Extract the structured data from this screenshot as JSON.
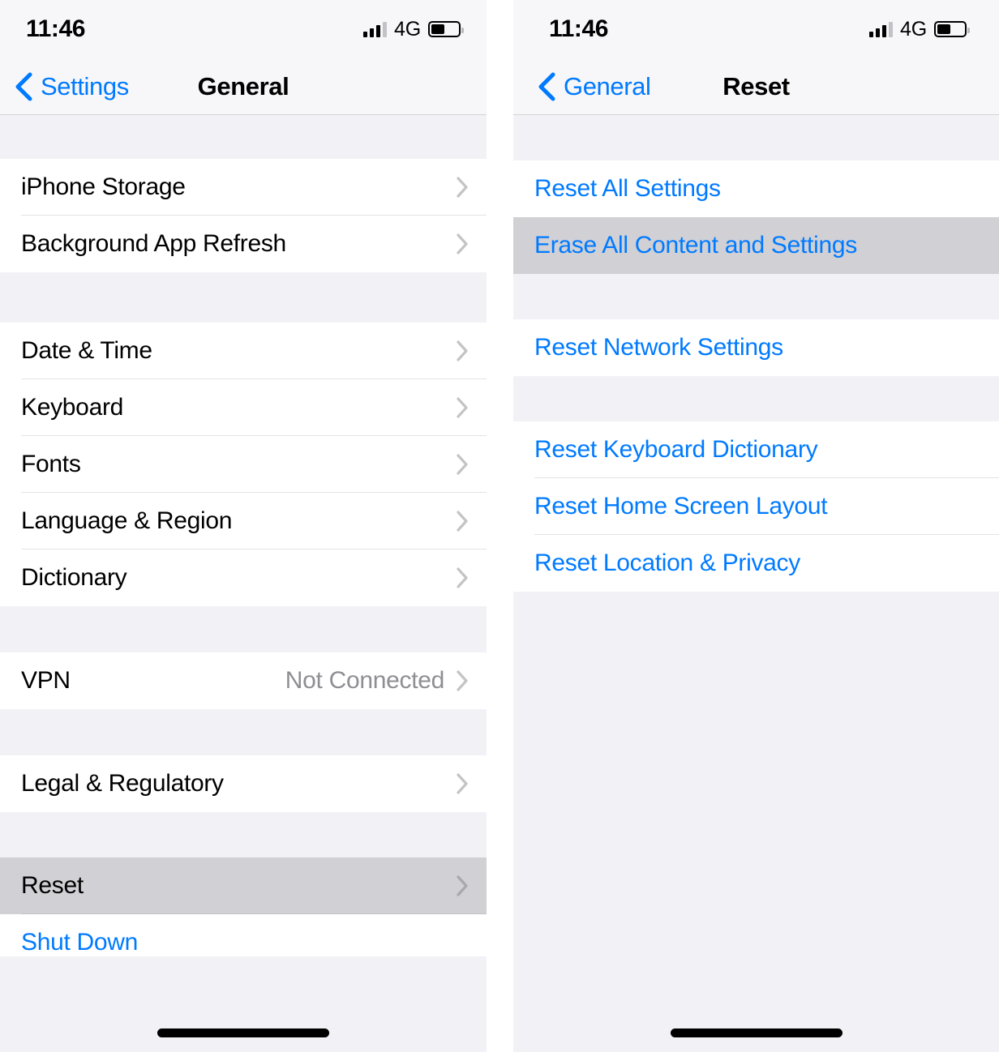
{
  "accent_color": "#007aff",
  "highlight_color": "#d0d0d5",
  "group_bg_color": "#f2f1f6",
  "screens": [
    {
      "id": "general",
      "status": {
        "time": "11:46",
        "carrier": "4G",
        "signal_icon": "cellular-bars-icon",
        "battery_icon": "battery-icon",
        "battery_level": 50
      },
      "nav": {
        "back_label": "Settings",
        "back_icon": "chevron-left-icon",
        "title": "General"
      },
      "sections": [
        {
          "rows": [
            {
              "label": "iPhone Storage",
              "value": "",
              "accessory": "chevron-right-icon",
              "style": "default",
              "selected": false
            },
            {
              "label": "Background App Refresh",
              "value": "",
              "accessory": "chevron-right-icon",
              "style": "default",
              "selected": false
            }
          ]
        },
        {
          "rows": [
            {
              "label": "Date & Time",
              "value": "",
              "accessory": "chevron-right-icon",
              "style": "default",
              "selected": false
            },
            {
              "label": "Keyboard",
              "value": "",
              "accessory": "chevron-right-icon",
              "style": "default",
              "selected": false
            },
            {
              "label": "Fonts",
              "value": "",
              "accessory": "chevron-right-icon",
              "style": "default",
              "selected": false
            },
            {
              "label": "Language & Region",
              "value": "",
              "accessory": "chevron-right-icon",
              "style": "default",
              "selected": false
            },
            {
              "label": "Dictionary",
              "value": "",
              "accessory": "chevron-right-icon",
              "style": "default",
              "selected": false
            }
          ]
        },
        {
          "rows": [
            {
              "label": "VPN",
              "value": "Not Connected",
              "accessory": "chevron-right-icon",
              "style": "default",
              "selected": false
            }
          ]
        },
        {
          "rows": [
            {
              "label": "Legal & Regulatory",
              "value": "",
              "accessory": "chevron-right-icon",
              "style": "default",
              "selected": false
            }
          ]
        },
        {
          "rows": [
            {
              "label": "Reset",
              "value": "",
              "accessory": "chevron-right-icon",
              "style": "default",
              "selected": true
            },
            {
              "label": "Shut Down",
              "value": "",
              "accessory": "none",
              "style": "blue",
              "selected": false
            }
          ]
        }
      ]
    },
    {
      "id": "reset",
      "status": {
        "time": "11:46",
        "carrier": "4G",
        "signal_icon": "cellular-bars-icon",
        "battery_icon": "battery-icon",
        "battery_level": 50
      },
      "nav": {
        "back_label": "General",
        "back_icon": "chevron-left-icon",
        "title": "Reset"
      },
      "sections": [
        {
          "rows": [
            {
              "label": "Reset All Settings",
              "value": "",
              "accessory": "none",
              "style": "blue",
              "selected": false
            },
            {
              "label": "Erase All Content and Settings",
              "value": "",
              "accessory": "none",
              "style": "blue",
              "selected": true
            }
          ]
        },
        {
          "rows": [
            {
              "label": "Reset Network Settings",
              "value": "",
              "accessory": "none",
              "style": "blue",
              "selected": false
            }
          ]
        },
        {
          "rows": [
            {
              "label": "Reset Keyboard Dictionary",
              "value": "",
              "accessory": "none",
              "style": "blue",
              "selected": false
            },
            {
              "label": "Reset Home Screen Layout",
              "value": "",
              "accessory": "none",
              "style": "blue",
              "selected": false
            },
            {
              "label": "Reset Location & Privacy",
              "value": "",
              "accessory": "none",
              "style": "blue",
              "selected": false
            }
          ]
        }
      ]
    }
  ]
}
